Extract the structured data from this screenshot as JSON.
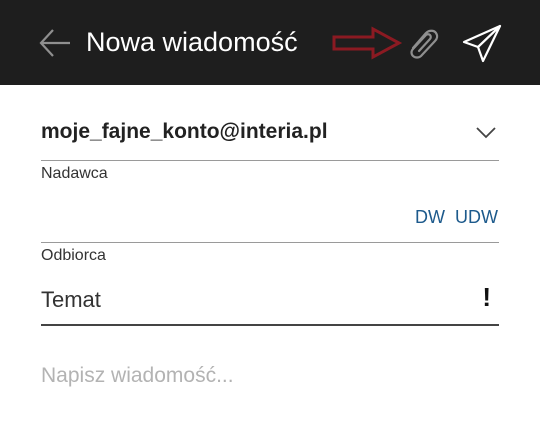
{
  "header": {
    "title": "Nowa wiadomość",
    "icons": {
      "back": "arrow-left-icon",
      "attach": "paperclip-icon",
      "send": "paper-plane-icon",
      "annotation": "red-arrow-annotation"
    },
    "colors": {
      "background": "#1e1e1e",
      "title": "#ffffff",
      "annotation": "#8b1a22"
    }
  },
  "sender": {
    "value": "moje_fajne_konto@interia.pl",
    "label": "Nadawca",
    "dropdown_icon": "chevron-down-icon"
  },
  "recipient": {
    "label": "Odbiorca",
    "value": "",
    "dw_label": "DW",
    "udw_label": "UDW",
    "link_color": "#1d5a8c"
  },
  "subject": {
    "placeholder": "Temat",
    "priority_label": "!"
  },
  "message": {
    "placeholder": "Napisz wiadomość..."
  }
}
